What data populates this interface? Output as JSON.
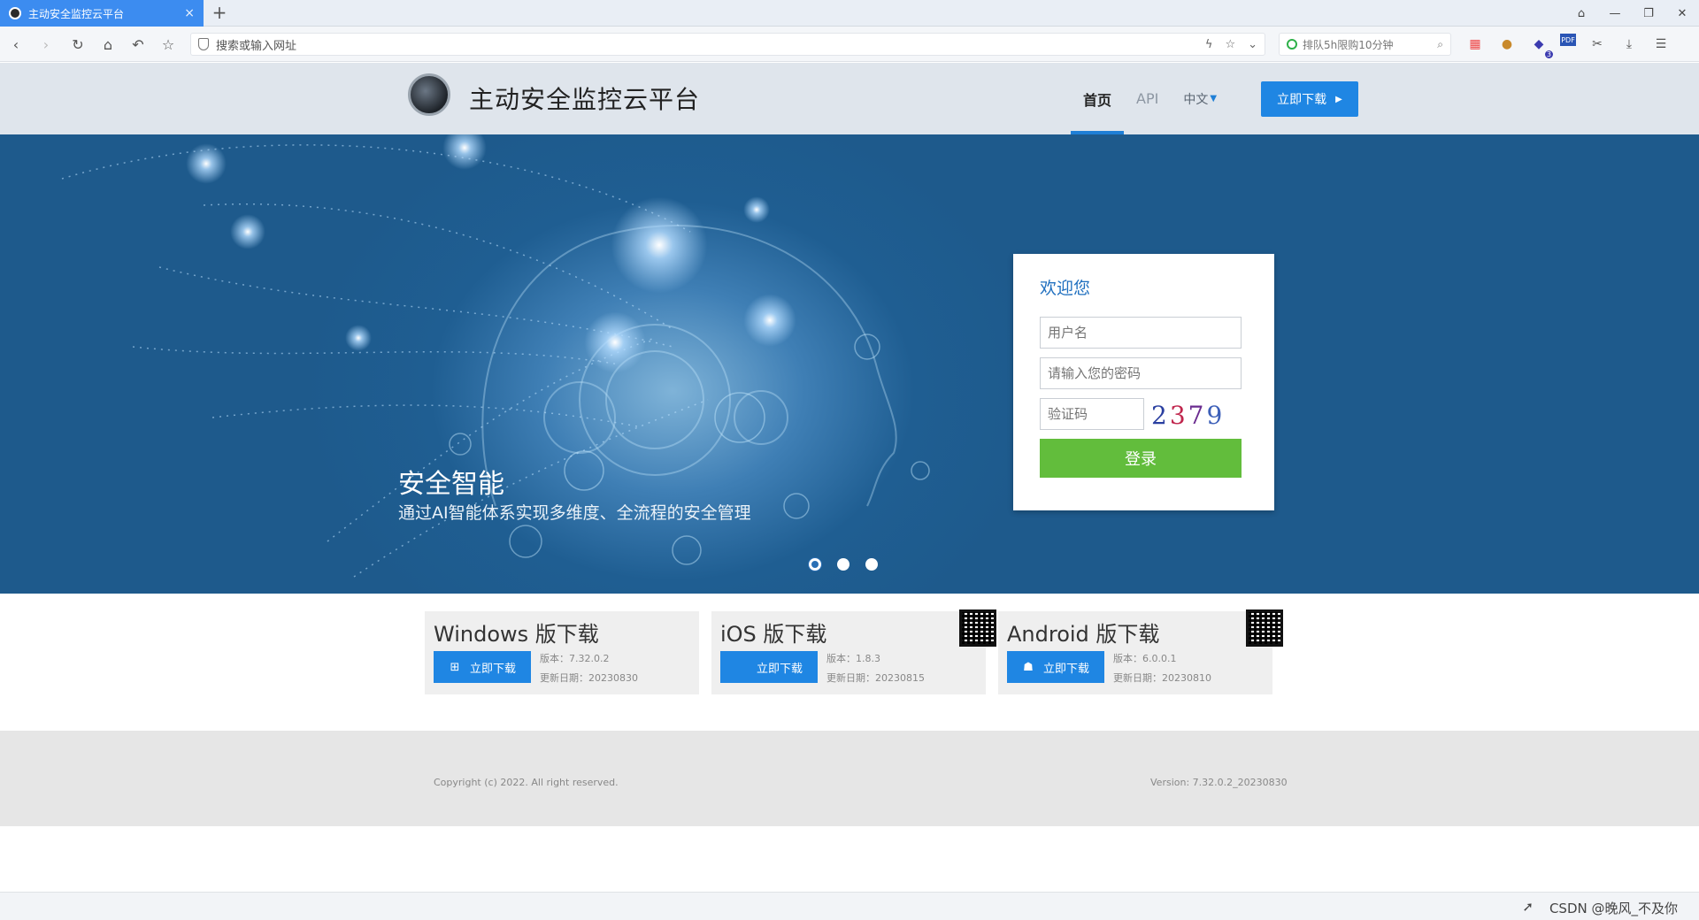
{
  "browser": {
    "tab_title": "主动安全监控云平台",
    "tab_close": "×",
    "newtab": "+",
    "address_placeholder": "搜索或输入网址",
    "search_box_text": "排队5h限购10分钟",
    "ext_badge": "3",
    "ext_pdf": "PDF",
    "window_controls": [
      "⌂",
      "—",
      "❐",
      "✕"
    ]
  },
  "site": {
    "title": "主动安全监控云平台",
    "nav": [
      {
        "label": "首页",
        "active": true
      },
      {
        "label": "API",
        "active": false
      }
    ],
    "lang": "中文",
    "download_btn": "立即下载"
  },
  "banner": {
    "title": "安全智能",
    "subtitle": "通过AI智能体系实现多维度、全流程的安全管理",
    "slides": 3,
    "active_slide": 0
  },
  "login": {
    "title": "欢迎您",
    "username_placeholder": "用户名",
    "password_placeholder": "请输入您的密码",
    "captcha_placeholder": "验证码",
    "captcha_text": [
      "2",
      "3",
      "7",
      "9"
    ],
    "submit": "登录"
  },
  "downloads": [
    {
      "name": "Windows 版下载",
      "button": "立即下载",
      "version": "版本：7.32.0.2",
      "date": "更新日期：20230830",
      "icon": "windows-icon"
    },
    {
      "name": "iOS 版下载",
      "button": "立即下载",
      "version": "版本：1.8.3",
      "date": "更新日期：20230815",
      "icon": "apple-icon"
    },
    {
      "name": "Android 版下载",
      "button": "立即下载",
      "version": "版本：6.0.0.1",
      "date": "更新日期：20230810",
      "icon": "android-icon"
    }
  ],
  "footer": {
    "copyright": "Copyright (c) 2022. All right reserved.",
    "version": "Version: 7.32.0.2_20230830"
  },
  "statusbar": {
    "watermark": "CSDN @晚风_不及你"
  },
  "colors": {
    "accent": "#1f86e3",
    "login_button": "#62bd3c",
    "banner": "#1f5e92",
    "tab": "#3c8cf0"
  }
}
